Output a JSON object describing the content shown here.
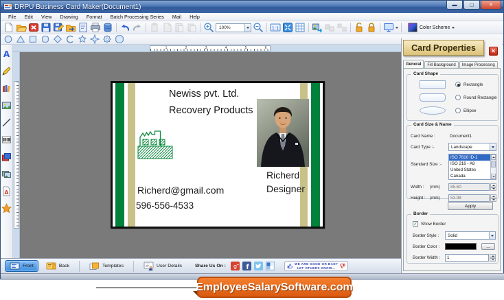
{
  "window": {
    "title": "DRPU Business Card Maker(Document1)",
    "controls": [
      "minimize",
      "maximize",
      "close"
    ]
  },
  "menu": {
    "items": [
      "File",
      "Edit",
      "View",
      "Drawing",
      "Format",
      "Batch Processing Series",
      "Mail",
      "Help"
    ]
  },
  "toolbar": {
    "zoom_value": "100%",
    "color_scheme_label": "Color Scheme",
    "icons": [
      "new-document",
      "open",
      "close-document",
      "save",
      "save-as",
      "export",
      "print-preview",
      "print",
      "database-backup",
      "undo",
      "redo",
      "copy",
      "cut",
      "paste",
      "duplicate",
      "zoom-in",
      "zoom-out",
      "actual-size",
      "fit-to-screen",
      "show-grid",
      "export-image",
      "group",
      "ungroup",
      "unlock",
      "lock",
      "display-mode"
    ]
  },
  "shape_toolbar": {
    "shapes": [
      "ellipse",
      "triangle",
      "rectangle",
      "round-rectangle",
      "diamond",
      "arc",
      "star",
      "four-point-star",
      "gear",
      "polygon"
    ]
  },
  "left_toolbar": {
    "tools": [
      "text",
      "pencil",
      "clipart",
      "image",
      "line",
      "barcode",
      "templates",
      "gallery",
      "wordart",
      "symbol"
    ]
  },
  "ruler": {
    "ticks": [
      "1",
      "2",
      "3",
      "4",
      "5",
      "6"
    ]
  },
  "card": {
    "company_name": "Newiss pvt. Ltd.",
    "tagline": "Recovery Products",
    "person_name": "Richerd",
    "person_title": "Designer",
    "email": "Richerd@gmail.com",
    "phone": "596-556-4533",
    "colors": {
      "stripe_green": "#00823c",
      "stripe_tan": "#c8c28a",
      "border": "#000000"
    }
  },
  "properties_panel": {
    "title": "Card Properties",
    "tabs": [
      {
        "label": "General",
        "active": true
      },
      {
        "label": "Fill Background",
        "active": false
      },
      {
        "label": "Image Processing",
        "active": false
      }
    ],
    "card_shape": {
      "legend": "Card Shape",
      "options": [
        {
          "label": "Rectangle",
          "selected": true
        },
        {
          "label": "Round Rectangle",
          "selected": false
        },
        {
          "label": "Ellipse",
          "selected": false
        }
      ]
    },
    "card_size": {
      "legend": "Card Size & Name",
      "card_name_label": "Card Name :",
      "card_name_value": "Document1",
      "card_type_label": "Card Type :-",
      "card_type_value": "Landscape",
      "standard_size_label": "Standard Size :-",
      "standard_sizes": [
        {
          "label": "ISO 7810 ID-1",
          "selected": true
        },
        {
          "label": "ISO 216 - A8",
          "selected": false
        },
        {
          "label": "United States",
          "selected": false
        },
        {
          "label": "Canada",
          "selected": false
        }
      ],
      "width_label": "Width :",
      "width_unit": "(mm)",
      "width_value": "85.60",
      "height_label": "Height :",
      "height_unit": "(mm)",
      "height_value": "53.98",
      "apply_label": "Apply"
    },
    "border": {
      "legend": "Border",
      "show_border_label": "Show Border",
      "show_border_checked": true,
      "style_label": "Border Style :",
      "style_value": "Solid",
      "color_label": "Border Color :",
      "color_value": "#000000",
      "browse_label": "...",
      "width_label": "Border Width :",
      "width_value": "1"
    }
  },
  "bottom_bar": {
    "front_label": "Front",
    "back_label": "Back",
    "templates_label": "Templates",
    "user_details_label": "User Details",
    "share_label": "Share Us On :",
    "social_icons": [
      "google-plus",
      "facebook",
      "twitter",
      "delicious"
    ],
    "feedback_line1": "WE ARE GOOD OR BAD?",
    "feedback_line2": "LET OTHERS KNOW..."
  },
  "footer": {
    "brand": "EmployeeSalarySoftware.com"
  }
}
